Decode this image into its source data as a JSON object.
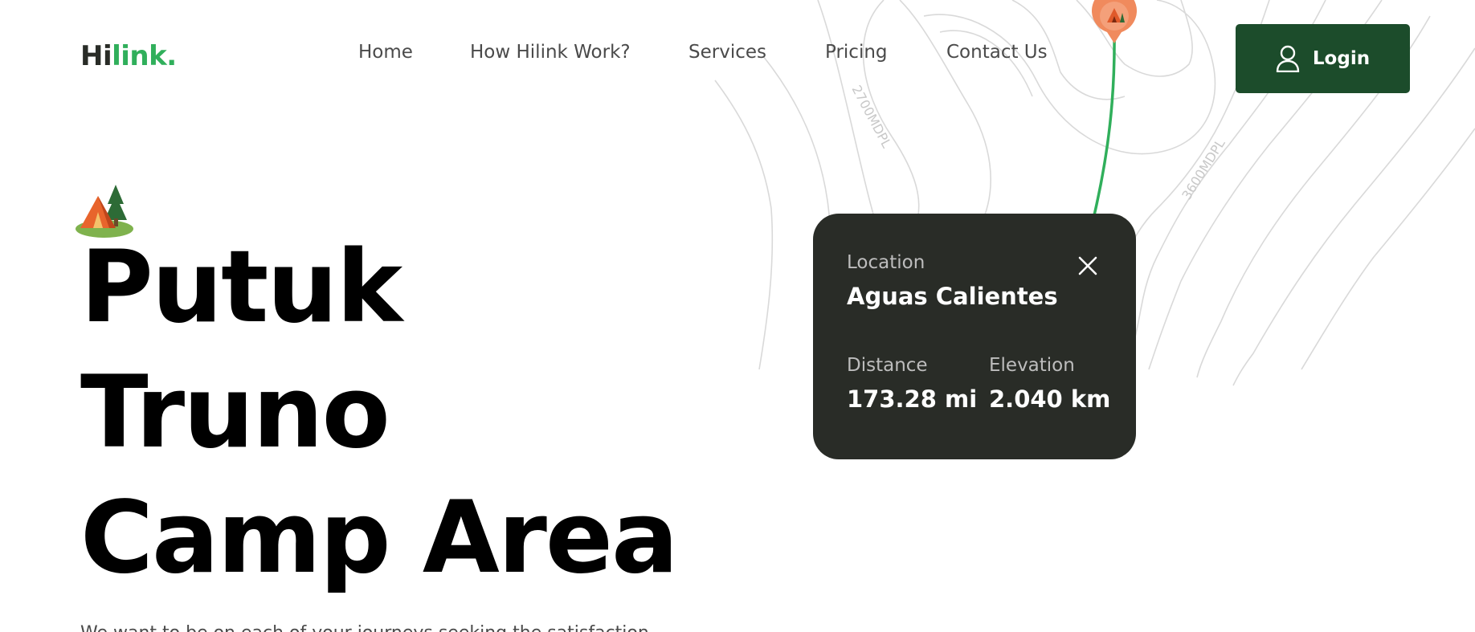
{
  "brand": {
    "logo_main": "Hi",
    "logo_accent": "link."
  },
  "nav": {
    "items": [
      {
        "label": "Home"
      },
      {
        "label": "How Hilink Work?"
      },
      {
        "label": "Services"
      },
      {
        "label": "Pricing"
      },
      {
        "label": "Contact Us"
      }
    ]
  },
  "login": {
    "label": "Login",
    "icon": "user-icon"
  },
  "hero": {
    "icon": "camp-tent-icon",
    "title_lines": [
      "Putuk",
      "Truno",
      "Camp Area"
    ],
    "subtitle": "We want to be on each of your journeys seeking the satisfaction"
  },
  "map": {
    "contour_labels": [
      "2700MDPL",
      "3600MDPL"
    ],
    "pin_icon": "camp-pin-icon",
    "route_color": "#30AF5B",
    "pin_color": "#F08A5D"
  },
  "location_card": {
    "location_label": "Location",
    "location_value": "Aguas Calientes",
    "distance_label": "Distance",
    "distance_value": "173.28 mi",
    "elevation_label": "Elevation",
    "elevation_value": "2.040 km",
    "close_icon": "close-icon"
  },
  "colors": {
    "brand_green": "#30AF5B",
    "dark_green": "#1C4C2B",
    "card_bg": "#292C27",
    "text_dark": "#292C27"
  }
}
